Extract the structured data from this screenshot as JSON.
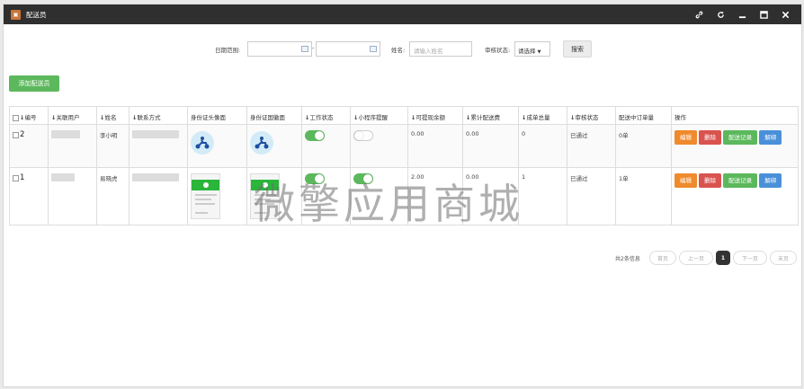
{
  "window": {
    "title": "配送员",
    "controls": [
      "link-icon",
      "refresh-icon",
      "minimize-icon",
      "maximize-icon",
      "close-icon"
    ]
  },
  "filters": {
    "date_label": "日期范围:",
    "date_sep": "-",
    "name_label": "姓名:",
    "name_placeholder": "请输入姓名",
    "status_label": "审核状态:",
    "status_value": "请选择",
    "search_button": "搜索"
  },
  "add_button": "添加配送员",
  "table": {
    "headers": [
      "编号",
      "关联用户",
      "姓名",
      "联系方式",
      "身份证头像面",
      "身份证国徽面",
      "工作状态",
      "小程序提醒",
      "可提现余额",
      "累计配送费",
      "成单总量",
      "审核状态",
      "配送中订单量",
      "操作"
    ],
    "rows": [
      {
        "id": "2",
        "name": "李小明",
        "work_on": true,
        "remind_on": false,
        "withdrawable": "0.00",
        "total_fee": "0.00",
        "orders": "0",
        "audit": "已通过",
        "delivering": "0单"
      },
      {
        "id": "1",
        "name": "易晓虎",
        "work_on": true,
        "remind_on": true,
        "withdrawable": "2.00",
        "total_fee": "0.00",
        "orders": "1",
        "audit": "已通过",
        "delivering": "1单"
      }
    ],
    "actions": {
      "edit": "编辑",
      "delete": "删除",
      "records": "配送记录",
      "unbind": "解绑"
    }
  },
  "pagination": {
    "info": "共2条信息",
    "first": "首页",
    "prev": "上一页",
    "current": "1",
    "next": "下一页",
    "last": "末页"
  },
  "watermark": "微擎应用商城",
  "colors": {
    "titlebar": "#2f2f2f",
    "green": "#5cb85c",
    "orange": "#ef8a2d",
    "red": "#d9534f",
    "blue": "#4a90d9"
  }
}
